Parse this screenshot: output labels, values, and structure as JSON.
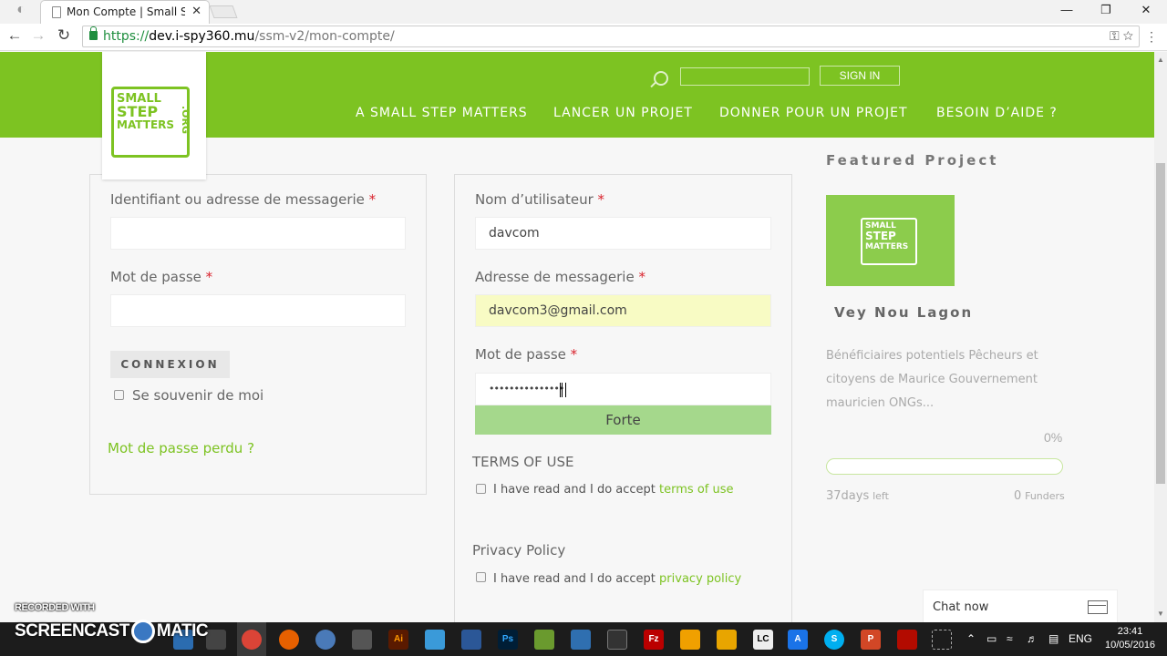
{
  "browser": {
    "tab_title": "Mon Compte | Small Step",
    "url_scheme": "https://",
    "url_host": "dev.i-spy360.mu",
    "url_path": "/ssm-v2/mon-compte/"
  },
  "header": {
    "logo": {
      "line1": "SMALL",
      "line2": "STEP",
      "line3": "MATTERS",
      "suffix": ".ORG"
    },
    "signin_label": "SIGN IN",
    "nav": [
      "A SMALL STEP MATTERS",
      "LANCER UN PROJET",
      "DONNER POUR UN PROJET",
      "BESOIN D’AIDE ?"
    ]
  },
  "login": {
    "username_label": "Identifiant ou adresse de messagerie",
    "required_mark": "*",
    "username_value": "",
    "password_label": "Mot de passe",
    "password_value": "",
    "submit_label": "CONNEXION",
    "remember_label": "Se souvenir de moi",
    "lost_password": "Mot de passe perdu ?"
  },
  "register": {
    "username_label": "Nom d’utilisateur",
    "username_value": "davcom",
    "email_label": "Adresse de messagerie",
    "email_value": "davcom3@gmail.com",
    "password_label": "Mot de passe",
    "password_mask": "•••••••••••••••",
    "strength": "Forte",
    "terms_heading": "TERMS OF USE",
    "terms_text": "I have read and I do accept",
    "terms_link": "terms of use",
    "privacy_heading": "Privacy Policy",
    "privacy_text": "I have read and I do accept",
    "privacy_link": "privacy policy"
  },
  "featured": {
    "heading": "Featured Project",
    "name": "Vey Nou Lagon",
    "description": "Bénéficiaires potentiels Pêcheurs et citoyens de Maurice Gouvernement mauricien ONGs...",
    "percent_label": "0%",
    "progress_fraction": 0,
    "days_value": "37days",
    "days_unit": "left",
    "funders_value": "0",
    "funders_unit": "Funders"
  },
  "chat": {
    "label": "Chat now"
  },
  "taskbar": {
    "watermark_line1": "RECORDED WITH",
    "watermark_line2a": "SCREENCAST",
    "watermark_line2b": "MATIC",
    "lang": "ENG",
    "time": "23:41",
    "date": "10/05/2016"
  },
  "colors": {
    "brand_green": "#7dc322",
    "required_red": "#d9232d",
    "email_autofill": "#f8fbc4",
    "strength_bar": "#a5d88c"
  }
}
